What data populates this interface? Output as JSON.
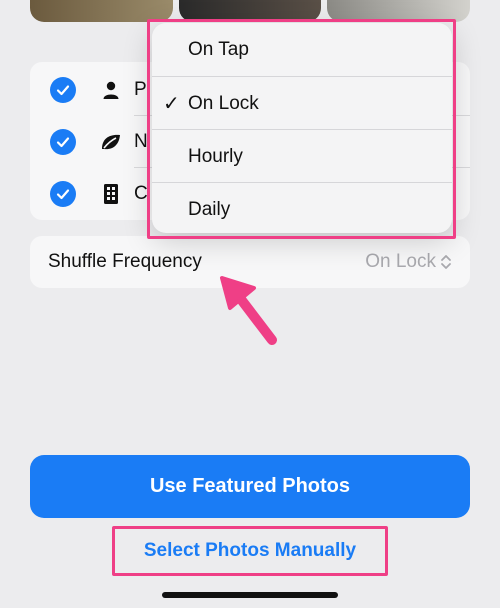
{
  "categories": [
    {
      "label": "P",
      "icon": "person-icon",
      "checked": true
    },
    {
      "label": "N",
      "icon": "leaf-icon",
      "checked": true
    },
    {
      "label": "C",
      "icon": "building-icon",
      "checked": true
    }
  ],
  "shuffle": {
    "label": "Shuffle Frequency",
    "value": "On Lock",
    "value_icon": "chevron-up-down-icon"
  },
  "menu": {
    "items": [
      {
        "label": "On Tap",
        "selected": false
      },
      {
        "label": "On Lock",
        "selected": true,
        "check": "✓"
      },
      {
        "label": "Hourly",
        "selected": false
      },
      {
        "label": "Daily",
        "selected": false
      }
    ]
  },
  "buttons": {
    "featured": "Use Featured Photos",
    "manual": "Select Photos Manually"
  },
  "colors": {
    "accent": "#1a7cf5",
    "highlight": "#ef3f86",
    "background": "#ececee"
  }
}
